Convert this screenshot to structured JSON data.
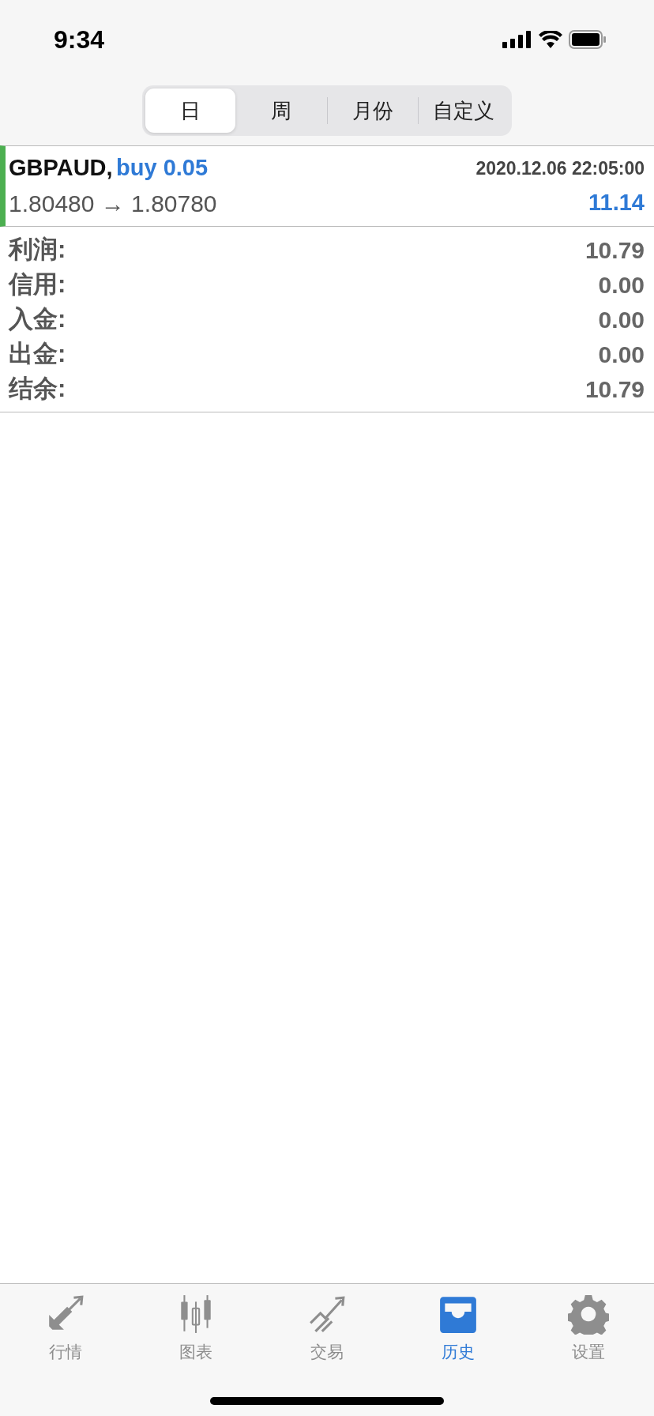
{
  "status_bar": {
    "time": "9:34"
  },
  "period_tabs": [
    {
      "label": "日",
      "selected": true
    },
    {
      "label": "周",
      "selected": false
    },
    {
      "label": "月份",
      "selected": false
    },
    {
      "label": "自定义",
      "selected": false
    }
  ],
  "deal": {
    "symbol": "GBPAUD,",
    "side": "buy 0.05",
    "time": "2020.12.06 22:05:00",
    "open_price": "1.80480",
    "arrow": "→",
    "close_price": "1.80780",
    "profit": "11.14"
  },
  "summary": [
    {
      "label": "利润:",
      "value": "10.79"
    },
    {
      "label": "信用:",
      "value": "0.00"
    },
    {
      "label": "入金:",
      "value": "0.00"
    },
    {
      "label": "出金:",
      "value": "0.00"
    },
    {
      "label": "结余:",
      "value": "10.79"
    }
  ],
  "tab_bar": [
    {
      "label": "行情",
      "selected": false
    },
    {
      "label": "图表",
      "selected": false
    },
    {
      "label": "交易",
      "selected": false
    },
    {
      "label": "历史",
      "selected": true
    },
    {
      "label": "设置",
      "selected": false
    }
  ]
}
